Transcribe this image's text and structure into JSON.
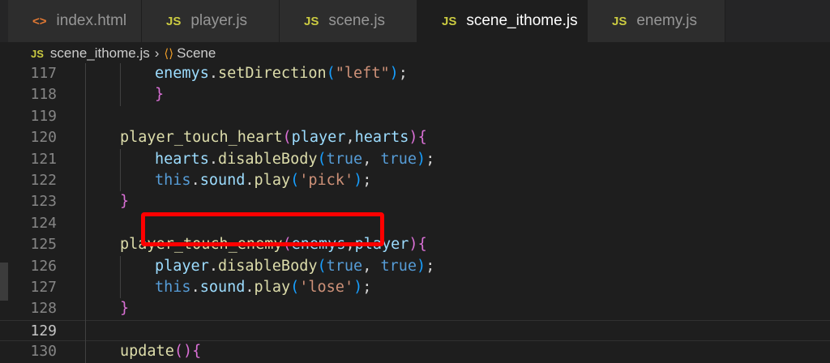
{
  "tabs": [
    {
      "icon": "<>",
      "icon_type": "html",
      "label": "index.html"
    },
    {
      "icon": "JS",
      "icon_type": "js",
      "label": "player.js"
    },
    {
      "icon": "JS",
      "icon_type": "js",
      "label": "scene.js"
    },
    {
      "icon": "JS",
      "icon_type": "js",
      "label": "scene_ithome.js",
      "active": true,
      "close": "✕"
    },
    {
      "icon": "JS",
      "icon_type": "js",
      "label": "enemy.js"
    }
  ],
  "breadcrumb": {
    "file_icon": "JS",
    "file": "scene_ithome.js",
    "separator": "›",
    "symbol_icon": "⟨⟩",
    "symbol": "Scene"
  },
  "lines": [
    {
      "num": "117",
      "tokens": [
        [
          "enemys",
          "var"
        ],
        [
          ".",
          "p"
        ],
        [
          "setDirection",
          "fn"
        ],
        [
          "(",
          "b3"
        ],
        [
          "\"left\"",
          "str"
        ],
        [
          ")",
          "b3"
        ],
        [
          ";",
          "p"
        ]
      ],
      "indent": 2
    },
    {
      "num": "118",
      "tokens": [
        [
          "}",
          "b2"
        ]
      ],
      "indent": 2
    },
    {
      "num": "119",
      "tokens": [],
      "indent": 0
    },
    {
      "num": "120",
      "tokens": [
        [
          "player_touch_heart",
          "fn"
        ],
        [
          "(",
          "b2"
        ],
        [
          "player",
          "var"
        ],
        [
          ",",
          "p"
        ],
        [
          "hearts",
          "var"
        ],
        [
          ")",
          "b2"
        ],
        [
          "{",
          "b2"
        ]
      ],
      "indent": 1
    },
    {
      "num": "121",
      "tokens": [
        [
          "hearts",
          "var"
        ],
        [
          ".",
          "p"
        ],
        [
          "disableBody",
          "fn"
        ],
        [
          "(",
          "b3"
        ],
        [
          "true",
          "kw"
        ],
        [
          ", ",
          "p"
        ],
        [
          "true",
          "kw"
        ],
        [
          ")",
          "b3"
        ],
        [
          ";",
          "p"
        ]
      ],
      "indent": 2
    },
    {
      "num": "122",
      "tokens": [
        [
          "this",
          "kw"
        ],
        [
          ".",
          "p"
        ],
        [
          "sound",
          "var"
        ],
        [
          ".",
          "p"
        ],
        [
          "play",
          "fn"
        ],
        [
          "(",
          "b3"
        ],
        [
          "'pick'",
          "str"
        ],
        [
          ")",
          "b3"
        ],
        [
          ";",
          "p"
        ]
      ],
      "indent": 2
    },
    {
      "num": "123",
      "tokens": [
        [
          "}",
          "b2"
        ]
      ],
      "indent": 1
    },
    {
      "num": "124",
      "tokens": [],
      "indent": 0
    },
    {
      "num": "125",
      "tokens": [
        [
          "player_touch_enemy",
          "fn"
        ],
        [
          "(",
          "b2"
        ],
        [
          "enemys",
          "var"
        ],
        [
          ",",
          "p"
        ],
        [
          "player",
          "var"
        ],
        [
          ")",
          "b2"
        ],
        [
          "{",
          "b2"
        ]
      ],
      "indent": 1
    },
    {
      "num": "126",
      "tokens": [
        [
          "player",
          "var"
        ],
        [
          ".",
          "p"
        ],
        [
          "disableBody",
          "fn"
        ],
        [
          "(",
          "b3"
        ],
        [
          "true",
          "kw"
        ],
        [
          ", ",
          "p"
        ],
        [
          "true",
          "kw"
        ],
        [
          ")",
          "b3"
        ],
        [
          ";",
          "p"
        ]
      ],
      "indent": 2
    },
    {
      "num": "127",
      "tokens": [
        [
          "this",
          "kw"
        ],
        [
          ".",
          "p"
        ],
        [
          "sound",
          "var"
        ],
        [
          ".",
          "p"
        ],
        [
          "play",
          "fn"
        ],
        [
          "(",
          "b3"
        ],
        [
          "'lose'",
          "str"
        ],
        [
          ")",
          "b3"
        ],
        [
          ";",
          "p"
        ]
      ],
      "indent": 2
    },
    {
      "num": "128",
      "tokens": [
        [
          "}",
          "b2"
        ]
      ],
      "indent": 1
    },
    {
      "num": "129",
      "tokens": [],
      "indent": 0,
      "current": true
    },
    {
      "num": "130",
      "tokens": [
        [
          "update",
          "fn"
        ],
        [
          "(",
          "b2"
        ],
        [
          ")",
          "b2"
        ],
        [
          "{",
          "b2"
        ]
      ],
      "indent": 1
    }
  ]
}
